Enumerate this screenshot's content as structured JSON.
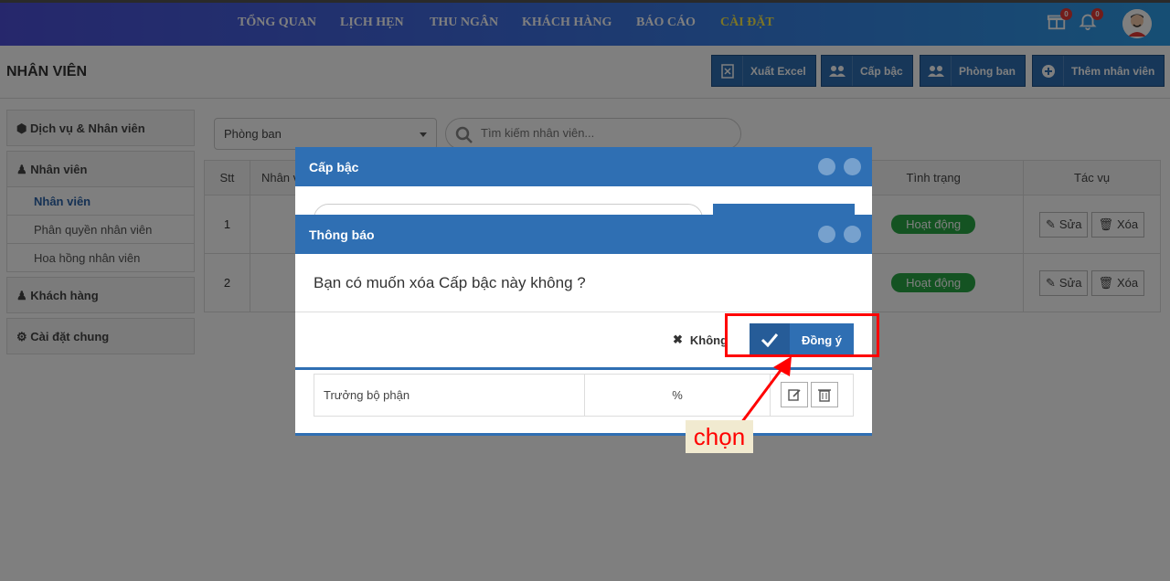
{
  "nav": {
    "items": [
      "TỔNG QUAN",
      "LỊCH HẸN",
      "THU NGÂN",
      "KHÁCH HÀNG",
      "BÁO CÁO",
      "CÀI ĐẶT"
    ],
    "active": "CÀI ĐẶT",
    "gift_badge": "0",
    "bell_badge": "0"
  },
  "page": {
    "title": "NHÂN VIÊN",
    "buttons": {
      "export": "Xuất Excel",
      "rank": "Cấp bậc",
      "department": "Phòng ban",
      "add_employee": "Thêm nhân viên"
    }
  },
  "sidebar": {
    "service_staff": "Dịch vụ & Nhân viên",
    "staff": "Nhân viên",
    "sub_items": [
      "Nhân viên",
      "Phân quyền nhân viên",
      "Hoa hồng nhân viên"
    ],
    "customers": "Khách hàng",
    "general_settings": "Cài đặt chung"
  },
  "filters": {
    "department_select": "Phòng ban",
    "search_placeholder": "Tìm kiếm nhân viên..."
  },
  "table": {
    "headers": {
      "stt": "Stt",
      "staff": "Nhân v",
      "status": "Tình trạng",
      "actions": "Tác vụ"
    },
    "rows": [
      {
        "stt": "1",
        "status": "Hoạt động",
        "edit": "Sửa",
        "delete": "Xóa"
      },
      {
        "stt": "2",
        "status": "Hoạt động",
        "edit": "Sửa",
        "delete": "Xóa"
      }
    ]
  },
  "rank_modal": {
    "title": "Cấp bậc",
    "row": {
      "name": "Trưởng bộ phận",
      "unit": "%"
    }
  },
  "confirm_modal": {
    "title": "Thông báo",
    "message": "Bạn có muốn xóa Cấp bậc này không ?",
    "cancel_label": "Không",
    "confirm_label": "Đồng ý"
  },
  "annotation": {
    "label": "chọn",
    "color": "#ff0000"
  }
}
